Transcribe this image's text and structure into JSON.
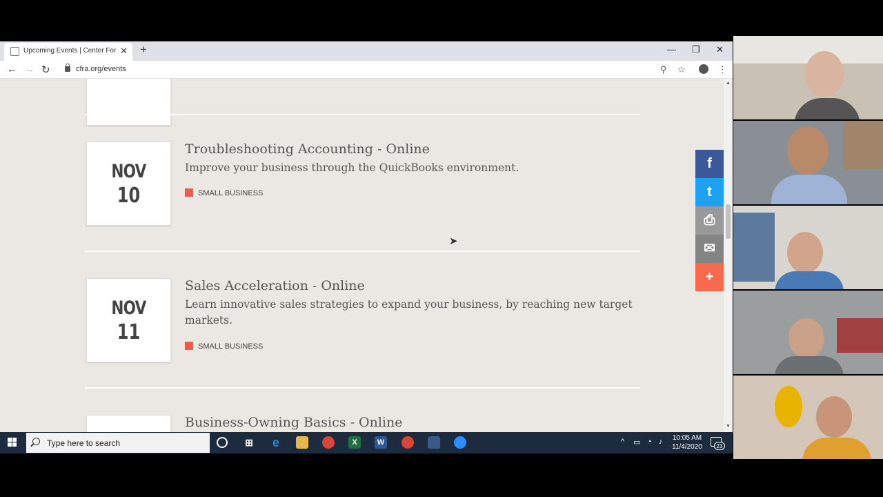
{
  "browser": {
    "tab_title": "Upcoming Events | Center For R",
    "tab_close": "✕",
    "new_tab": "+",
    "url": "cfra.org/events",
    "window_controls": [
      "—",
      "❐",
      "✕"
    ]
  },
  "events": [
    {
      "month": "NOV",
      "day": "10",
      "title": "Troubleshooting Accounting - Online",
      "description": "Improve your business through the QuickBooks environment.",
      "category": "SMALL BUSINESS"
    },
    {
      "month": "NOV",
      "day": "11",
      "title": "Sales Acceleration - Online",
      "description": "Learn innovative sales strategies to expand your business, by reaching new target markets.",
      "category": "SMALL BUSINESS"
    },
    {
      "month": "",
      "day": "",
      "title": "Business-Owning Basics - Online",
      "description": "",
      "category": ""
    }
  ],
  "share": {
    "facebook": "f",
    "twitter": "t",
    "print": "⎙",
    "email": "✉",
    "more": "+",
    "colors": {
      "facebook": "#3b5998",
      "twitter": "#1da1f2",
      "print": "#999999",
      "email": "#848484",
      "more": "#f8694d"
    }
  },
  "taskbar": {
    "search_placeholder": "Type here to search",
    "time": "10:05 AM",
    "date": "11/4/2020",
    "notifications": "23"
  }
}
